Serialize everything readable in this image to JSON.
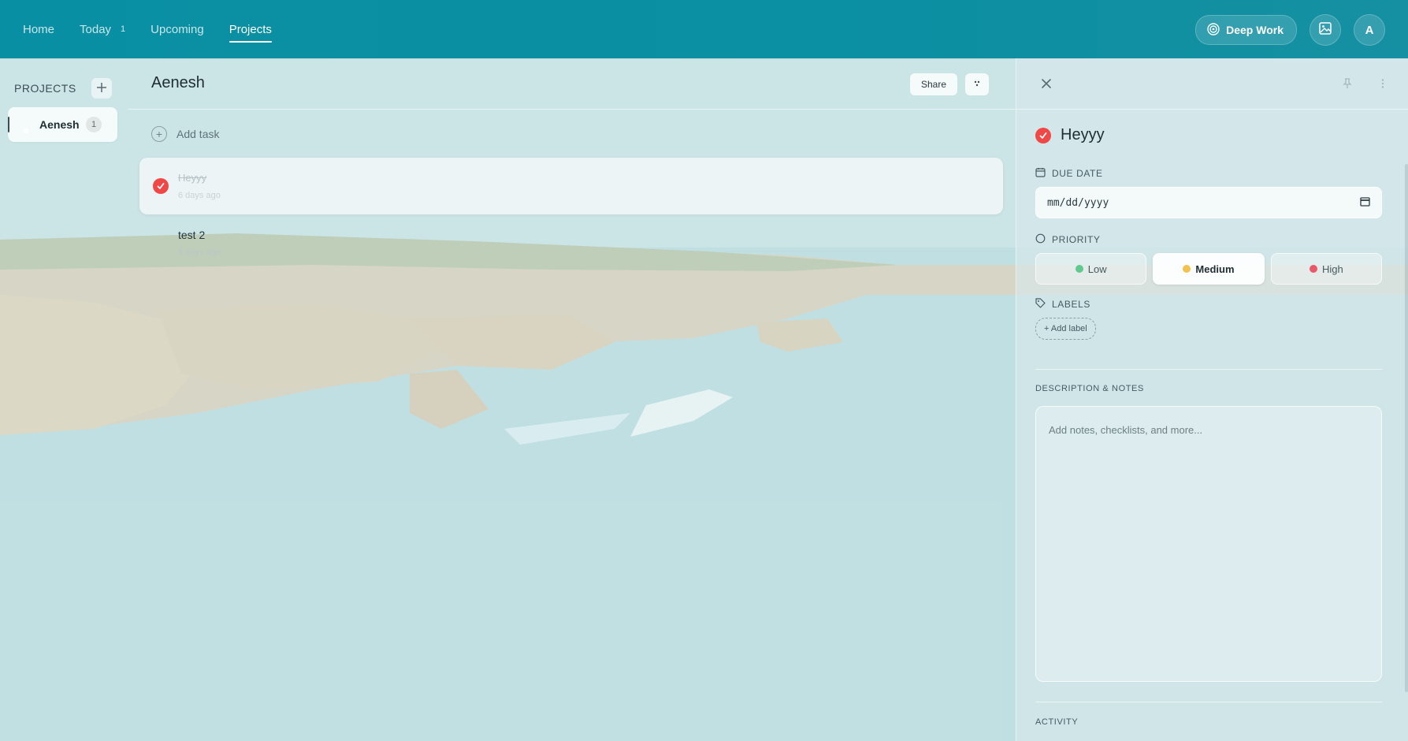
{
  "nav": {
    "items": [
      {
        "label": "Home",
        "badge": ""
      },
      {
        "label": "Today",
        "badge": "1"
      },
      {
        "label": "Upcoming",
        "badge": ""
      },
      {
        "label": "Projects",
        "badge": "",
        "active": true
      }
    ],
    "deep_work_label": "Deep Work",
    "background_button_icon": "image-icon",
    "avatar_initial": "A"
  },
  "sidebar": {
    "title": "PROJECTS",
    "add_icon": "plus-icon",
    "items": [
      {
        "label": "Aenesh",
        "count": "1"
      }
    ]
  },
  "main": {
    "title": "Aenesh",
    "share_label": "Share",
    "add_task_label": "Add task",
    "tasks": [
      {
        "title": "Heyyy",
        "meta": "6 days ago",
        "completed": true
      },
      {
        "title": "test 2",
        "meta": "5 days ago",
        "completed": false
      }
    ]
  },
  "detail": {
    "task_title": "Heyyy",
    "due_date_label": "DUE DATE",
    "due_date_placeholder": "mm/dd/yyyy",
    "priority_label": "PRIORITY",
    "priorities": [
      {
        "label": "Low",
        "color": "#5fc98f"
      },
      {
        "label": "Medium",
        "color": "#f2c14e",
        "selected": true
      },
      {
        "label": "High",
        "color": "#e8586a"
      }
    ],
    "labels_label": "LABELS",
    "add_label": "+ Add label",
    "description_label": "DESCRIPTION & NOTES",
    "notes_placeholder": "Add notes, checklists, and more...",
    "activity_label": "ACTIVITY"
  },
  "colors": {
    "topbar": "#0b8fa2",
    "complete_check": "#f04747"
  }
}
